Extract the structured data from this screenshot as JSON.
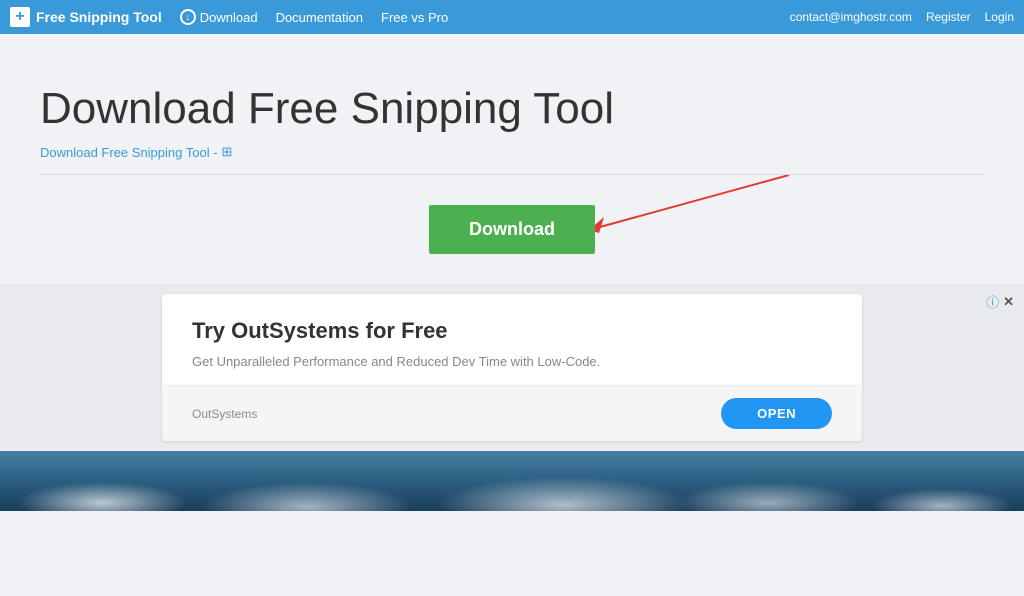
{
  "navbar": {
    "brand": "Free Snipping Tool",
    "download_label": "Download",
    "documentation_label": "Documentation",
    "freevspro_label": "Free vs Pro",
    "contact": "contact@imghostr.com",
    "register": "Register",
    "login": "Login"
  },
  "main": {
    "page_title": "Download Free Snipping Tool",
    "breadcrumb_text": "Download Free Snipping Tool -",
    "download_button": "Download",
    "divider": true
  },
  "ad": {
    "title": "Try OutSystems for Free",
    "description": "Get Unparalleled Performance and Reduced Dev Time with Low-Code.",
    "source": "OutSystems",
    "open_button": "OPEN",
    "info_icon": "ⓘ",
    "close_icon": "✕"
  },
  "bottom": {
    "image_alt": "clouds background"
  }
}
